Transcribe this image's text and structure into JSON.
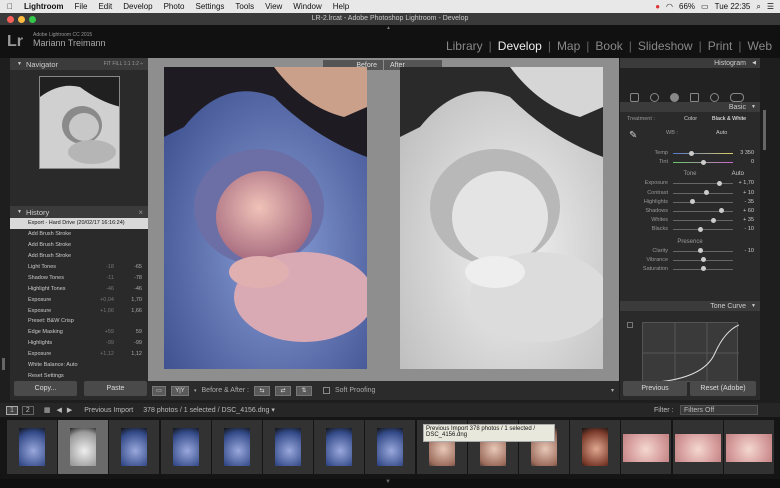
{
  "menubar": {
    "apple": "",
    "app": "Lightroom",
    "items": [
      "File",
      "Edit",
      "Develop",
      "Photo",
      "Settings",
      "Tools",
      "View",
      "Window",
      "Help"
    ],
    "battery": "66%",
    "clock": "Tue 22:35"
  },
  "window": {
    "title": "LR-2.lrcat - Adobe Photoshop Lightroom - Develop"
  },
  "identity": {
    "logo": "Lr",
    "product": "Adobe Lightroom CC 2015",
    "user": "Mariann Treimann",
    "modules": [
      "Library",
      "Develop",
      "Map",
      "Book",
      "Slideshow",
      "Print",
      "Web"
    ],
    "active_module": "Develop"
  },
  "navigator": {
    "title": "Navigator",
    "zoom": "FIT  FILL  1:1  1:2 ÷"
  },
  "history": {
    "title": "History",
    "close": "×",
    "items": [
      {
        "label": "Export - Hard Drive (20/02/17 16:16:24)",
        "v1": "",
        "v2": "",
        "selected": true
      },
      {
        "label": "Add Brush Stroke",
        "v1": "",
        "v2": ""
      },
      {
        "label": "Add Brush Stroke",
        "v1": "",
        "v2": ""
      },
      {
        "label": "Add Brush Stroke",
        "v1": "",
        "v2": ""
      },
      {
        "label": "Light Tones",
        "v1": "-18",
        "v2": "-65"
      },
      {
        "label": "Shadow Tones",
        "v1": "-11",
        "v2": "-78"
      },
      {
        "label": "Highlight Tones",
        "v1": "-46",
        "v2": "-46"
      },
      {
        "label": "Exposure",
        "v1": "+0,04",
        "v2": "1,70"
      },
      {
        "label": "Exposure",
        "v1": "+1,66",
        "v2": "1,66"
      },
      {
        "label": "Preset: B&W Crisp",
        "v1": "",
        "v2": ""
      },
      {
        "label": "Edge Masking",
        "v1": "+59",
        "v2": "59"
      },
      {
        "label": "Highlights",
        "v1": "-99",
        "v2": "-99"
      },
      {
        "label": "Exposure",
        "v1": "+1,12",
        "v2": "1,12"
      },
      {
        "label": "White Balance: Auto",
        "v1": "",
        "v2": ""
      },
      {
        "label": "Reset Settings",
        "v1": "",
        "v2": ""
      }
    ]
  },
  "left_buttons": {
    "copy": "Copy...",
    "paste": "Paste"
  },
  "view": {
    "before": "Before",
    "after": "After"
  },
  "toolbar": {
    "yy": "Y|Y",
    "mode": "Before & After :",
    "soft_proofing": "Soft Proofing"
  },
  "right": {
    "histogram": "Histogram",
    "basic": "Basic",
    "treatment_label": "Treatment :",
    "color": "Color",
    "bw": "Black & White",
    "wb_label": "WB :",
    "wb_value": "Auto",
    "tone_label": "Tone",
    "tone_auto": "Auto",
    "presence_label": "Presence",
    "sliders": [
      {
        "label": "Temp",
        "value": "3 350",
        "pos": 0.3
      },
      {
        "label": "Tint",
        "value": "0",
        "pos": 0.5
      },
      {
        "label": "Exposure",
        "value": "+ 1,70",
        "pos": 0.78
      },
      {
        "label": "Contrast",
        "value": "+ 10",
        "pos": 0.55
      },
      {
        "label": "Highlights",
        "value": "- 35",
        "pos": 0.32
      },
      {
        "label": "Shadows",
        "value": "+ 60",
        "pos": 0.8
      },
      {
        "label": "Whites",
        "value": "+ 35",
        "pos": 0.68
      },
      {
        "label": "Blacks",
        "value": "- 10",
        "pos": 0.45
      },
      {
        "label": "Clarity",
        "value": "- 10",
        "pos": 0.45
      },
      {
        "label": "Vibrance",
        "value": "",
        "pos": 0.5
      },
      {
        "label": "Saturation",
        "value": "",
        "pos": 0.5
      }
    ],
    "tone_curve": "Tone Curve",
    "previous": "Previous",
    "reset": "Reset (Adobe)"
  },
  "filmbar": {
    "page1": "1",
    "page2": "2",
    "source": "Previous Import",
    "count": "378 photos / 1 selected /",
    "file": "DSC_4156.dng ▾",
    "filter_label": "Filter :",
    "filter_value": "Filters Off"
  },
  "tooltip": {
    "line1": "Previous Import   378 photos / 1 selected /",
    "line2": "DSC_4156.dng"
  },
  "colors": {
    "accent": "#e8e8e8",
    "panel": "#2a2a2a",
    "center_bg": "#8e8e8e"
  }
}
